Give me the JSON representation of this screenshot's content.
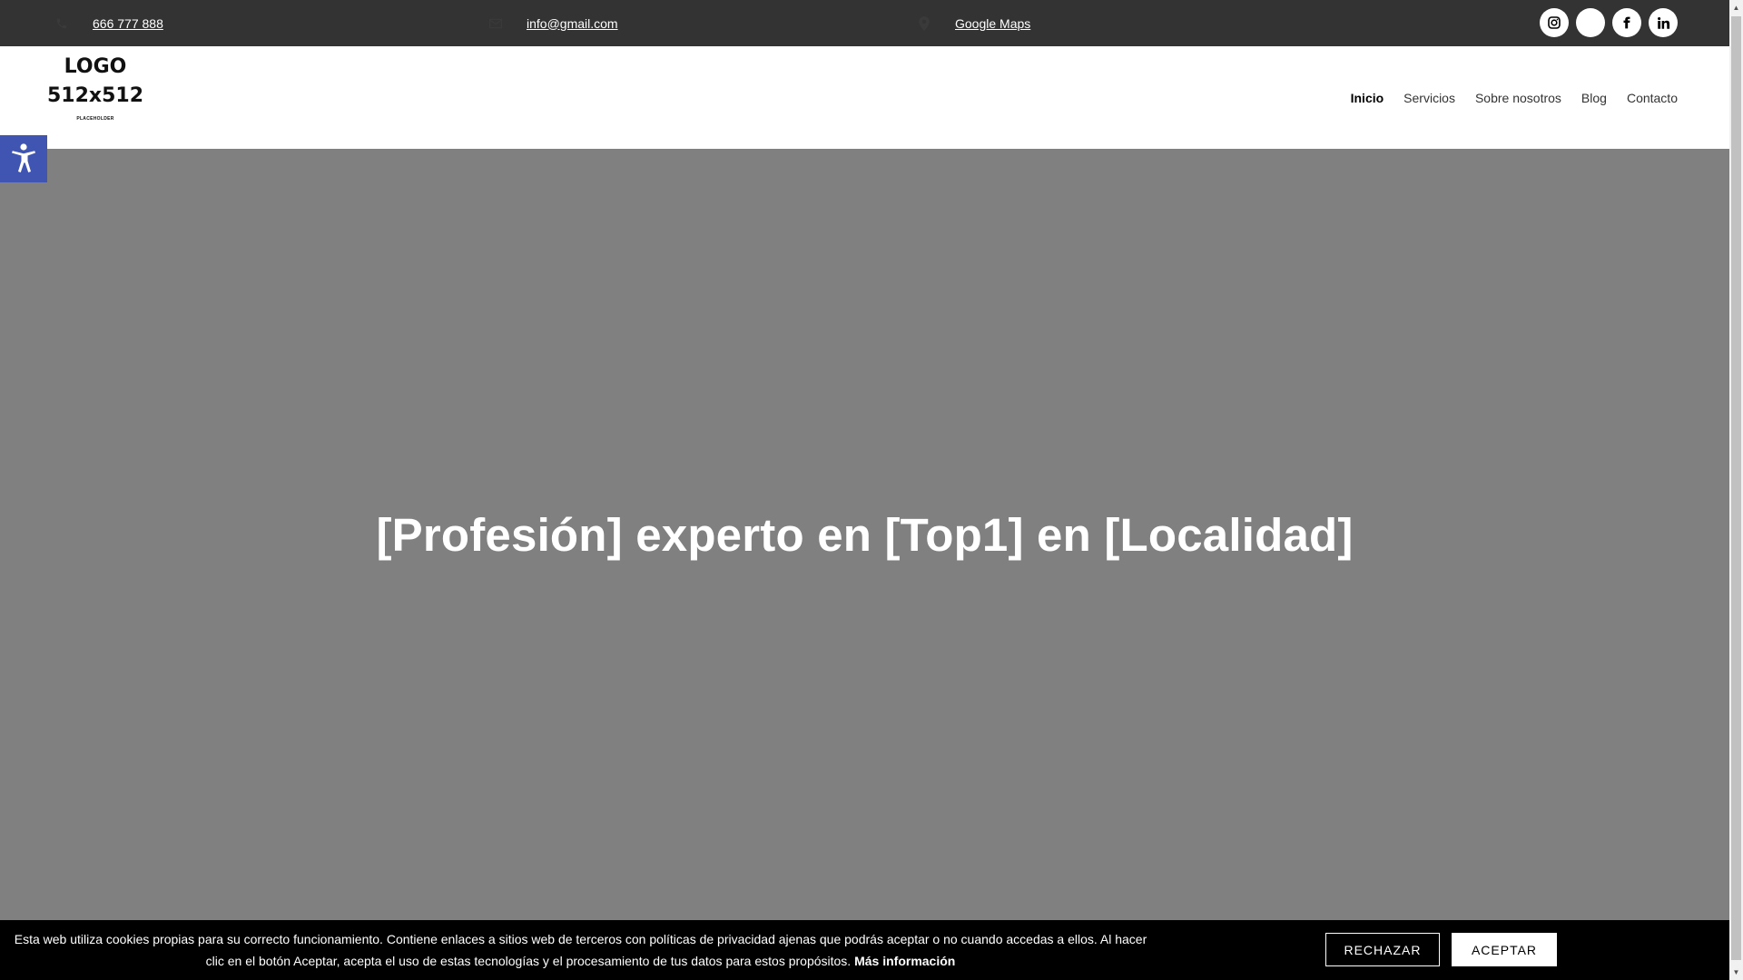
{
  "topbar": {
    "phone": "666 777 888",
    "email": "info@gmail.com",
    "map_link": "Google Maps",
    "icons": [
      "phone-icon",
      "mail-icon",
      "map-pin-icon"
    ],
    "social": [
      "instagram-icon",
      "twitter-icon",
      "facebook-icon",
      "linkedin-icon"
    ]
  },
  "header": {
    "logo_line1": "LOGO",
    "logo_line2": "512x512",
    "logo_line3": "PLACEHOLDER",
    "nav": [
      "Inicio",
      "Servicios",
      "Sobre nosotros",
      "Blog",
      "Contacto"
    ],
    "active_nav": "Inicio"
  },
  "hero": {
    "title": "[Profesión] experto en [Top1] en [Localidad]"
  },
  "cookie": {
    "text": "Esta web utiliza cookies propias para su correcto funcionamiento. Contiene enlaces a sitios web de terceros con políticas de privacidad ajenas que podrás aceptar o no cuando accedas a ellos. Al hacer clic en el botón Aceptar, acepta el uso de estas tecnologías y el procesamiento de tus datos para estos propósitos.",
    "more": "Más información",
    "reject": "RECHAZAR",
    "accept": "ACEPTAR"
  },
  "colors": {
    "topbar_bg": "#333333",
    "hero_bg": "#808080",
    "a11y_bg": "#4054b2",
    "cookie_bg": "#000000"
  }
}
